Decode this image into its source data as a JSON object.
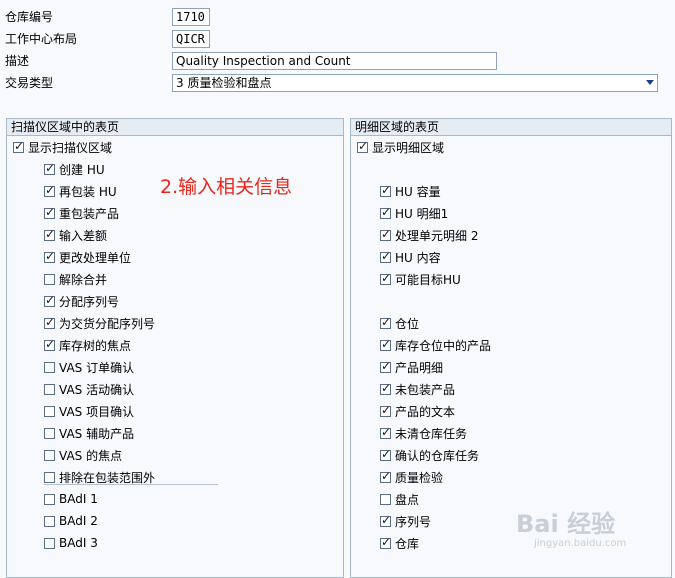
{
  "header": {
    "warehouse_label": "仓库编号",
    "warehouse_value": "1710",
    "layout_label": "工作中心布局",
    "layout_value": "QICR",
    "desc_label": "描述",
    "desc_value": "Quality Inspection and Count",
    "trans_label": "交易类型",
    "trans_value": "3 质量检验和盘点"
  },
  "left_panel": {
    "title": "扫描仪区域中的表页",
    "show_label": "显示扫描仪区域",
    "items": [
      {
        "label": "创建 HU",
        "checked": true
      },
      {
        "label": "再包装 HU",
        "checked": true
      },
      {
        "label": "重包装产品",
        "checked": true
      },
      {
        "label": "输入差额",
        "checked": true
      },
      {
        "label": "更改处理单位",
        "checked": true
      },
      {
        "label": "解除合并",
        "checked": false
      },
      {
        "label": "分配序列号",
        "checked": true
      },
      {
        "label": "为交货分配序列号",
        "checked": true
      },
      {
        "label": "库存树的焦点",
        "checked": true
      },
      {
        "label": "VAS 订单确认",
        "checked": false
      },
      {
        "label": "VAS 活动确认",
        "checked": false
      },
      {
        "label": "VAS 项目确认",
        "checked": false
      },
      {
        "label": "VAS 辅助产品",
        "checked": false
      },
      {
        "label": "VAS 的焦点",
        "checked": false
      },
      {
        "label": "排除在包装范围外",
        "checked": false
      },
      {
        "label": "BAdI 1",
        "checked": false
      },
      {
        "label": "BAdI 2",
        "checked": false
      },
      {
        "label": "BAdI 3",
        "checked": false
      }
    ]
  },
  "right_panel": {
    "title": "明细区域的表页",
    "show_label": "显示明细区域",
    "items": [
      {
        "label": "HU 容量",
        "checked": true
      },
      {
        "label": "HU 明细1",
        "checked": true
      },
      {
        "label": "处理单元明细 2",
        "checked": true
      },
      {
        "label": "HU 内容",
        "checked": true
      },
      {
        "label": "可能目标HU",
        "checked": true
      },
      {
        "label": "仓位",
        "checked": true
      },
      {
        "label": "库存仓位中的产品",
        "checked": true
      },
      {
        "label": "产品明细",
        "checked": true
      },
      {
        "label": "未包装产品",
        "checked": true
      },
      {
        "label": "产品的文本",
        "checked": true
      },
      {
        "label": "未清仓库任务",
        "checked": true
      },
      {
        "label": "确认的仓库任务",
        "checked": true
      },
      {
        "label": "质量检验",
        "checked": true
      },
      {
        "label": "盘点",
        "checked": false
      },
      {
        "label": "序列号",
        "checked": true
      },
      {
        "label": "仓库",
        "checked": true
      }
    ]
  },
  "annotation": "2.输入相关信息",
  "watermark": {
    "brand": "Bai 经验",
    "sub": "jingyan.baidu.com"
  }
}
